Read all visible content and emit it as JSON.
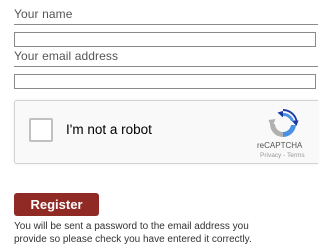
{
  "form": {
    "name_label": "Your name",
    "name_value": "",
    "email_label": "Your email address",
    "email_value": ""
  },
  "recaptcha": {
    "checkbox_label": "I'm not a robot",
    "brand": "reCAPTCHA",
    "privacy_link": "Privacy",
    "separator": " - ",
    "terms_link": "Terms",
    "logo_icon": "recaptcha-logo-icon",
    "colors": {
      "blue_dark": "#1c3aa9",
      "blue_light": "#4a90e2",
      "grey": "#b0b0b0"
    }
  },
  "register": {
    "button_label": "Register",
    "button_color": "#8f2a25",
    "help_line_1": "You will be sent a password to the email address you",
    "help_line_2": "provide so please check you have entered it correctly."
  }
}
